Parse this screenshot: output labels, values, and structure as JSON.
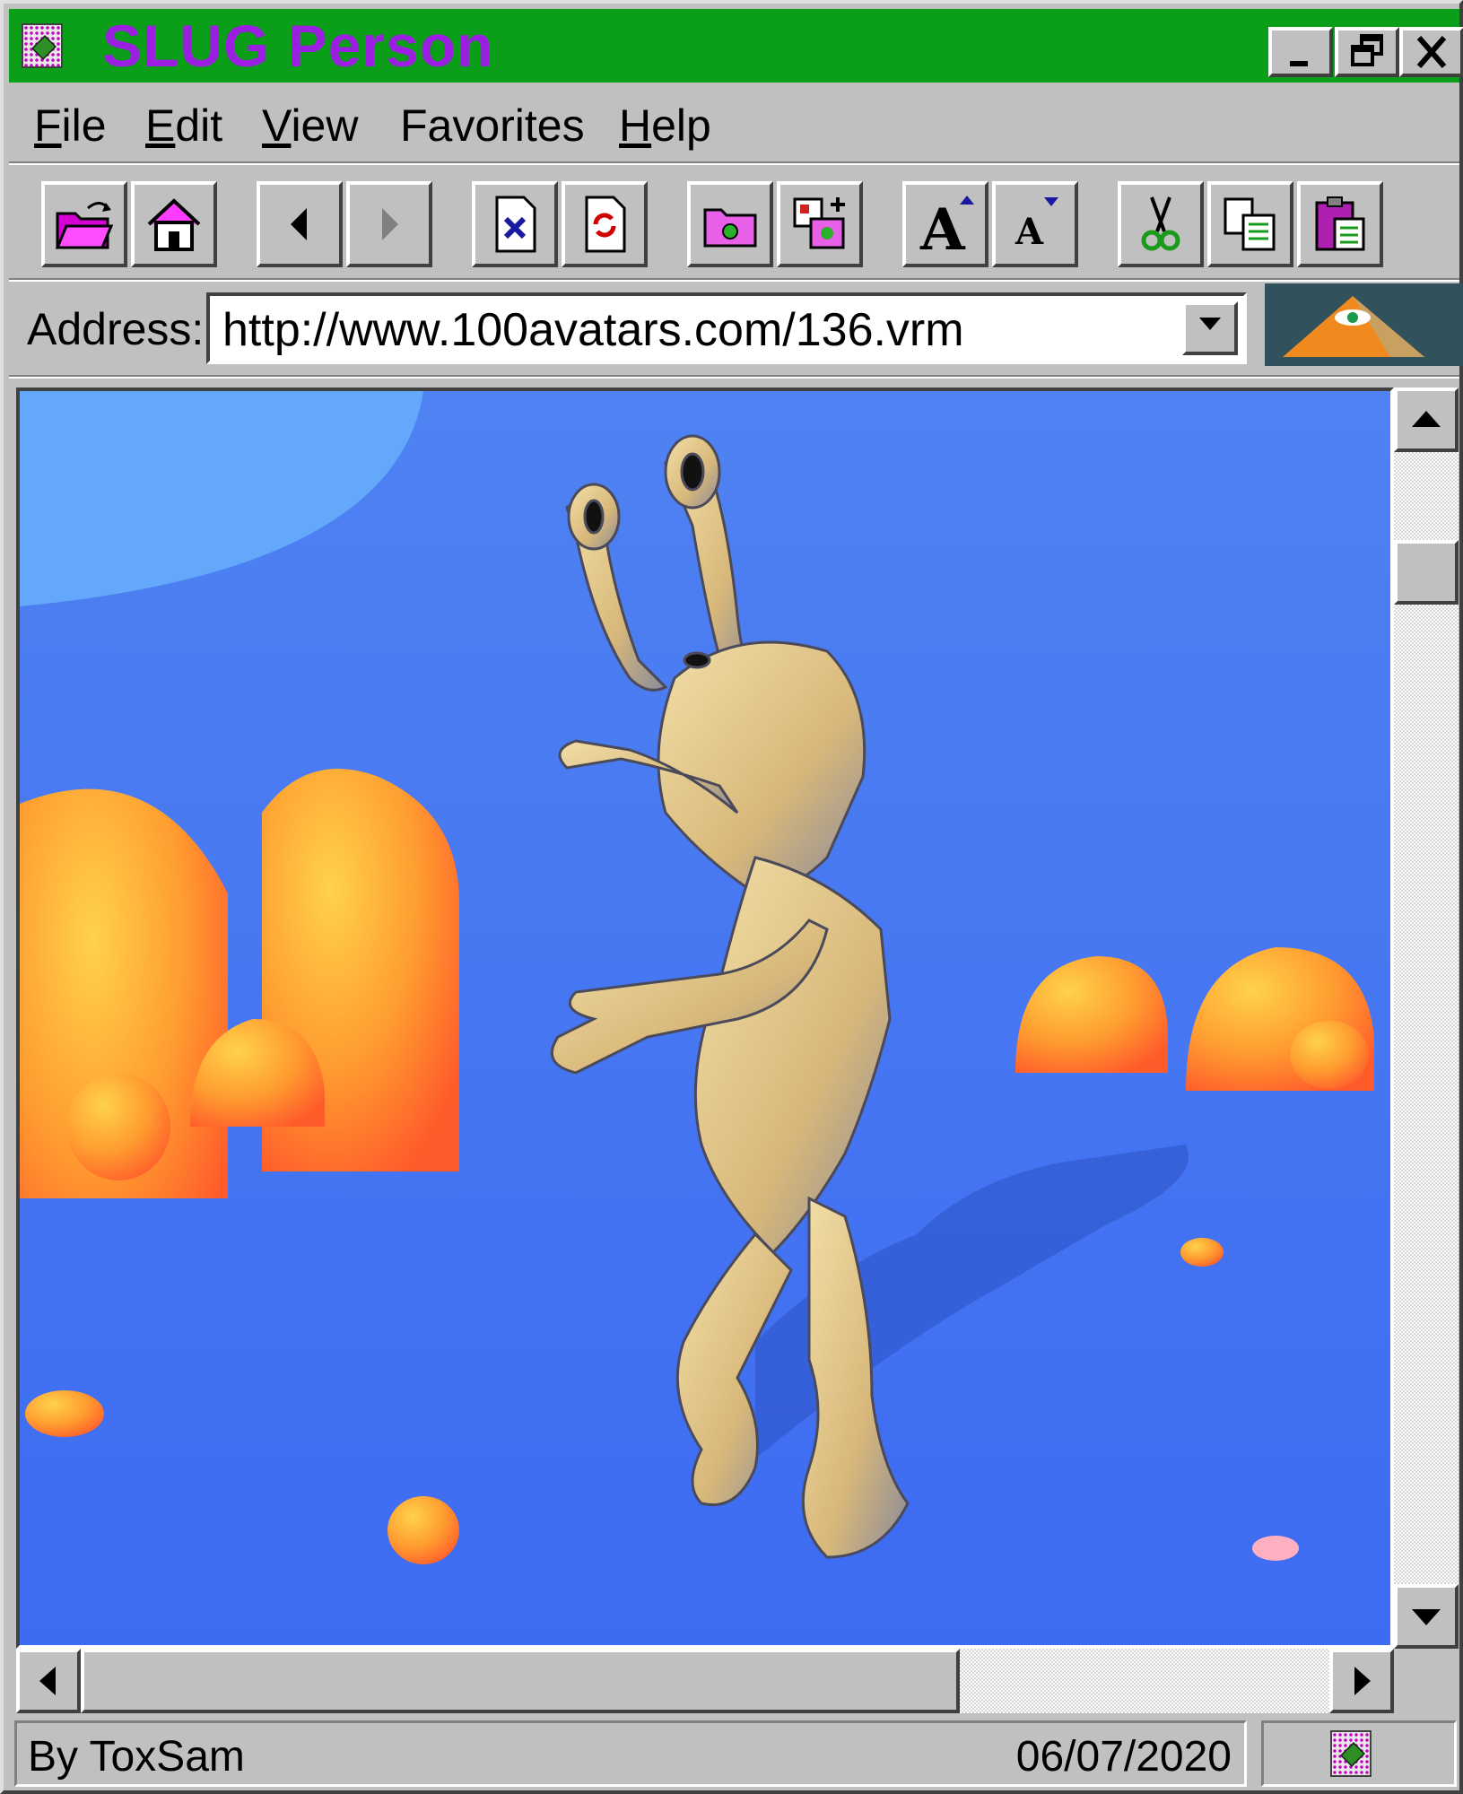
{
  "window": {
    "title": "SLUG Person",
    "title_color": "#9a1fe0",
    "titlebar_color": "#0b9e18",
    "controls": {
      "minimize": "_",
      "restore": "🗗",
      "close": "✕"
    }
  },
  "menu": [
    "File",
    "Edit",
    "View",
    "Favorites",
    "Help"
  ],
  "toolbar": {
    "buttons": [
      "open-folder-icon",
      "home-icon",
      "back-icon",
      "forward-icon",
      "stop-page-icon",
      "refresh-page-icon",
      "folder-image-icon",
      "add-image-icon",
      "increase-font-icon",
      "decrease-font-icon",
      "cut-icon",
      "copy-icon",
      "paste-icon"
    ]
  },
  "address": {
    "label": "Address:",
    "value": "http://www.100avatars.com/136.vrm"
  },
  "status": {
    "author": "By ToxSam",
    "date": "06/07/2020"
  }
}
